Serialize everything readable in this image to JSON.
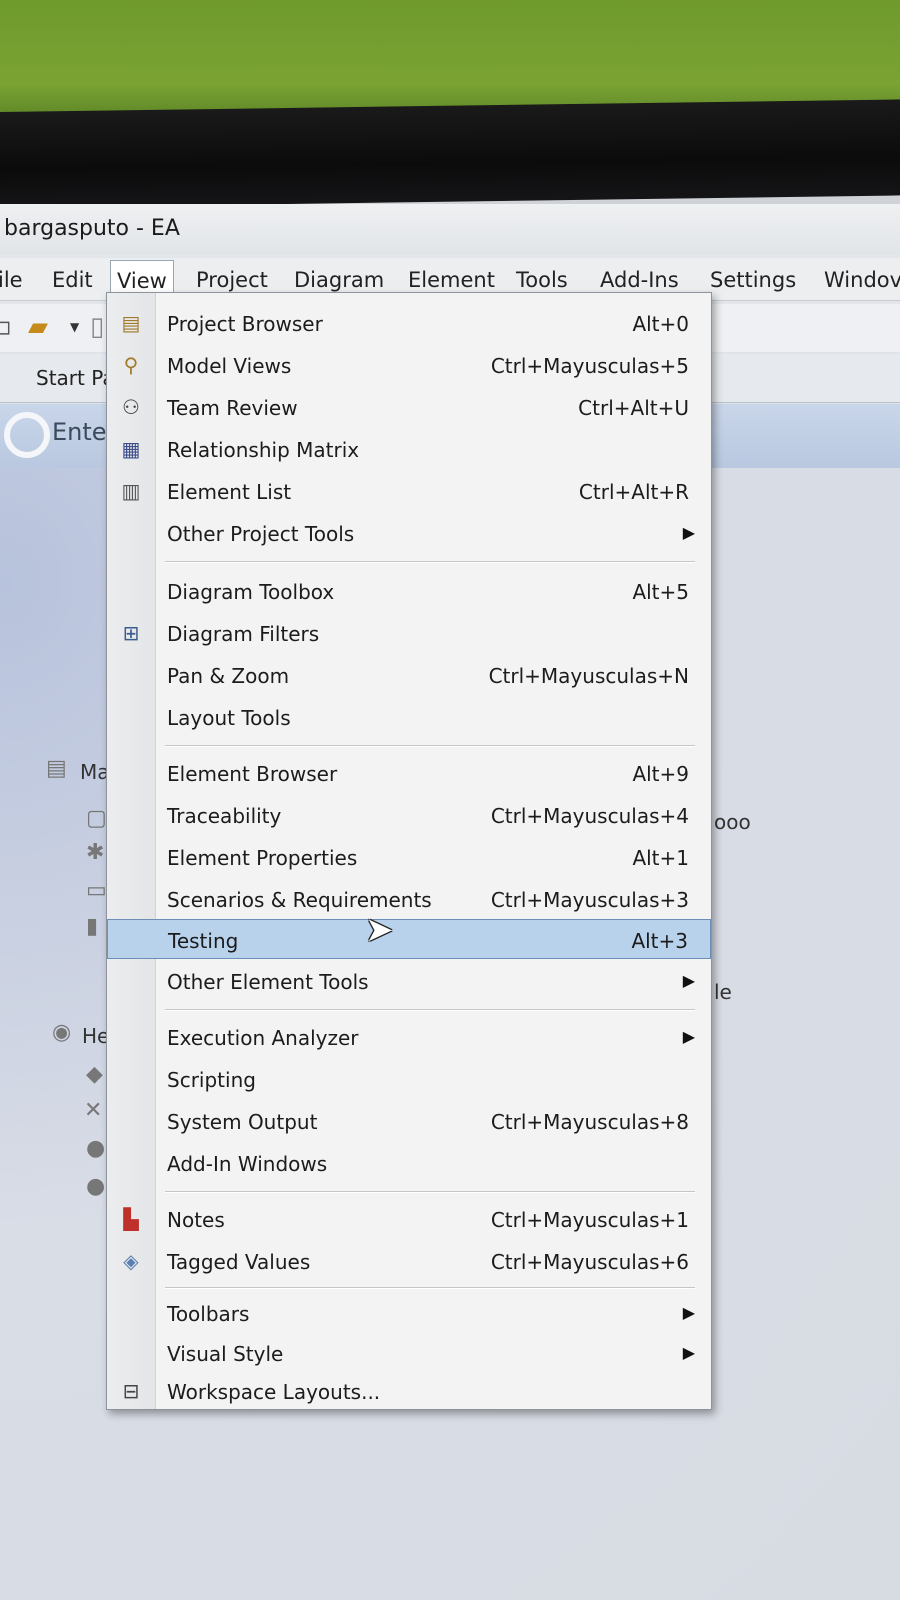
{
  "window": {
    "title": "bargasputo - EA"
  },
  "menubar": {
    "items": [
      {
        "label": "ile"
      },
      {
        "label": "Edit"
      },
      {
        "label": "View"
      },
      {
        "label": "Project"
      },
      {
        "label": "Diagram"
      },
      {
        "label": "Element"
      },
      {
        "label": "Tools"
      },
      {
        "label": "Add-Ins"
      },
      {
        "label": "Settings"
      },
      {
        "label": "Windov"
      }
    ]
  },
  "tabs": {
    "start_page": "Start Pa"
  },
  "header": {
    "logo_text": "Ente"
  },
  "background_fragments": {
    "section1": "Ma",
    "section2": "He",
    "frag_ooo": "ooo",
    "frag_le": "le"
  },
  "dropdown": {
    "items": [
      {
        "label": "Project Browser",
        "shortcut": "Alt+0",
        "icon": "project-browser-icon"
      },
      {
        "label": "Model Views",
        "shortcut": "Ctrl+Mayusculas+5",
        "icon": "model-views-icon"
      },
      {
        "label": "Team Review",
        "shortcut": "Ctrl+Alt+U",
        "icon": "team-review-icon"
      },
      {
        "label": "Relationship Matrix",
        "shortcut": "",
        "icon": "relationship-matrix-icon"
      },
      {
        "label": "Element List",
        "shortcut": "Ctrl+Alt+R",
        "icon": "element-list-icon"
      },
      {
        "label": "Other Project Tools",
        "shortcut": "",
        "icon": ""
      },
      {
        "label": "Diagram Toolbox",
        "shortcut": "Alt+5",
        "icon": ""
      },
      {
        "label": "Diagram Filters",
        "shortcut": "",
        "icon": "diagram-filters-icon"
      },
      {
        "label": "Pan & Zoom",
        "shortcut": "Ctrl+Mayusculas+N",
        "icon": ""
      },
      {
        "label": "Layout Tools",
        "shortcut": "",
        "icon": ""
      },
      {
        "label": "Element Browser",
        "shortcut": "Alt+9",
        "icon": ""
      },
      {
        "label": "Traceability",
        "shortcut": "Ctrl+Mayusculas+4",
        "icon": ""
      },
      {
        "label": "Element Properties",
        "shortcut": "Alt+1",
        "icon": ""
      },
      {
        "label": "Scenarios & Requirements",
        "shortcut": "Ctrl+Mayusculas+3",
        "icon": ""
      },
      {
        "label": "Testing",
        "shortcut": "Alt+3",
        "icon": ""
      },
      {
        "label": "Other Element Tools",
        "shortcut": "",
        "icon": ""
      },
      {
        "label": "Execution Analyzer",
        "shortcut": "",
        "icon": ""
      },
      {
        "label": "Scripting",
        "shortcut": "",
        "icon": ""
      },
      {
        "label": "System Output",
        "shortcut": "Ctrl+Mayusculas+8",
        "icon": ""
      },
      {
        "label": "Add-In Windows",
        "shortcut": "",
        "icon": ""
      },
      {
        "label": "Notes",
        "shortcut": "Ctrl+Mayusculas+1",
        "icon": "notes-icon"
      },
      {
        "label": "Tagged Values",
        "shortcut": "Ctrl+Mayusculas+6",
        "icon": "tagged-values-icon"
      },
      {
        "label": "Toolbars",
        "shortcut": "",
        "icon": ""
      },
      {
        "label": "Visual Style",
        "shortcut": "",
        "icon": ""
      },
      {
        "label": "Workspace Layouts...",
        "shortcut": "",
        "icon": "workspace-layouts-icon"
      }
    ],
    "highlighted": "Testing"
  },
  "colors": {
    "highlight": "#b8d2ec",
    "menu_bg": "#f3f3f3",
    "wall": "#7aa333"
  }
}
